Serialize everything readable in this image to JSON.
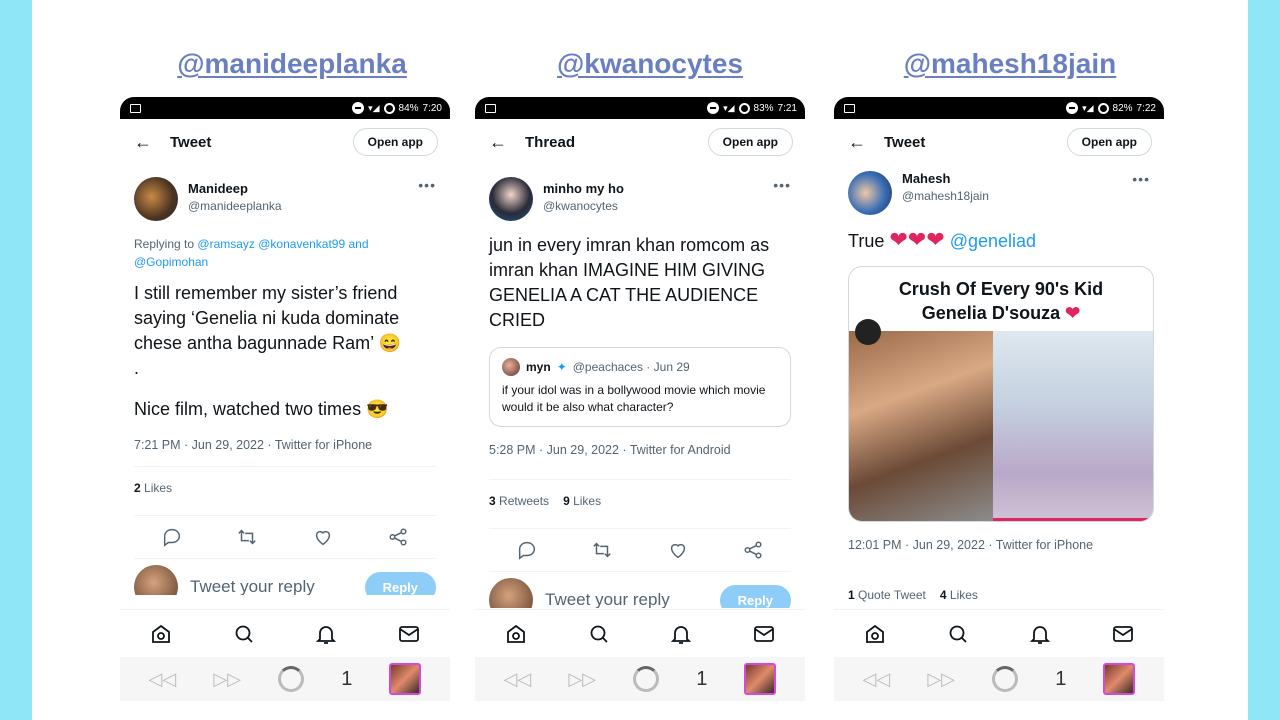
{
  "handles": [
    "@manideeplanka",
    "@kwanocytes",
    "@mahesh18jain"
  ],
  "phones": [
    {
      "status": {
        "battery": "84%",
        "time": "7:20"
      },
      "topbar": {
        "title": "Tweet",
        "open_app": "Open app"
      },
      "author": {
        "name": "Manideep",
        "username": "@manideeplanka"
      },
      "replying_to": {
        "prefix": "Replying to",
        "handles": "@ramsayz @konavenkat99 and @Gopimohan"
      },
      "text1": "I still remember my sister’s friend saying ‘Genelia ni kuda dominate chese antha bagunnade Ram’ 😄",
      "text_dot": ".",
      "text2": "Nice film, watched two times 😎",
      "meta": "7:21 PM · Jun 29, 2022 · Twitter for iPhone",
      "likes": {
        "count": "2",
        "label": "Likes"
      },
      "reply_placeholder": "Tweet your reply",
      "reply_button": "Reply",
      "tab_count": "1"
    },
    {
      "status": {
        "battery": "83%",
        "time": "7:21"
      },
      "topbar": {
        "title": "Thread",
        "open_app": "Open app"
      },
      "author": {
        "name": "minho my ho",
        "username": "@kwanocytes"
      },
      "text": "jun in every imran khan romcom as imran khan IMAGINE HIM GIVING GENELIA A CAT THE AUDIENCE CRIED",
      "quote": {
        "name": "myn",
        "username": "@peachaces · Jun 29",
        "text": "if your idol was in a bollywood movie which movie would it be also what character?"
      },
      "meta": "5:28 PM · Jun 29, 2022 · Twitter for Android",
      "retweets": {
        "count": "3",
        "label": "Retweets"
      },
      "likes": {
        "count": "9",
        "label": "Likes"
      },
      "reply_placeholder": "Tweet your reply",
      "reply_button": "Reply",
      "tab_count": "1"
    },
    {
      "status": {
        "battery": "82%",
        "time": "7:22"
      },
      "topbar": {
        "title": "Tweet",
        "open_app": "Open app"
      },
      "author": {
        "name": "Mahesh",
        "username": "@mahesh18jain"
      },
      "text_prefix": "True",
      "hearts": "❤❤❤",
      "mention": "@geneliad",
      "media": {
        "title_line1": "Crush Of Every 90's Kid",
        "title_line2": "Genelia D'souza",
        "heart": "❤"
      },
      "meta": "12:01 PM · Jun 29, 2022 · Twitter for iPhone",
      "quote_tweets": {
        "count": "1",
        "label": "Quote Tweet"
      },
      "likes": {
        "count": "4",
        "label": "Likes"
      },
      "tab_count": "1"
    }
  ],
  "colors": {
    "accent": "#1d9bf0",
    "handle": "#6a7fc1",
    "background": "#8fe6f7"
  }
}
